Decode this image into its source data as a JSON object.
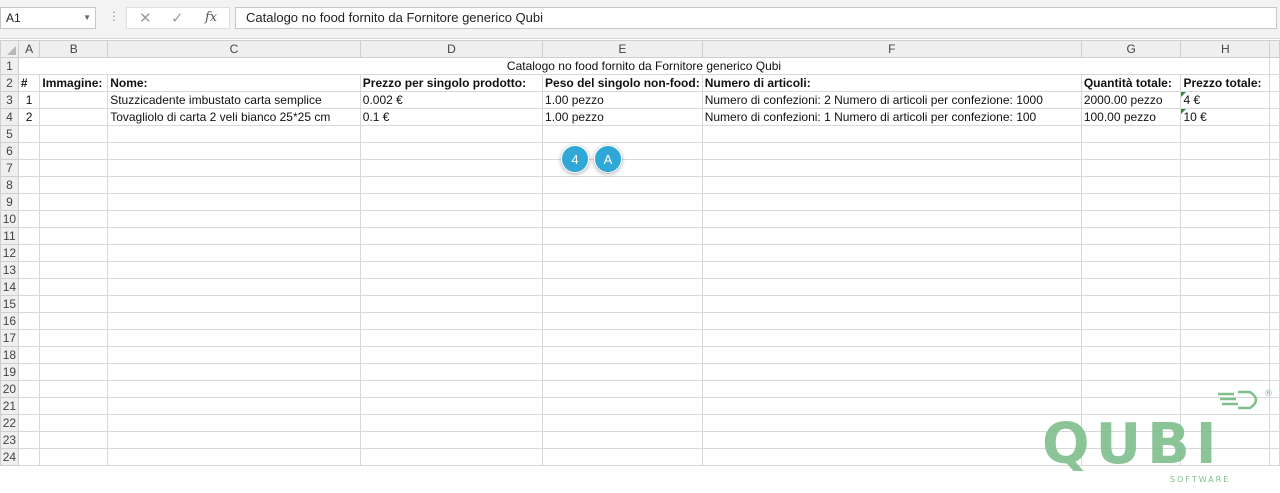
{
  "formula_bar": {
    "name_box": "A1",
    "formula": "Catalogo no food fornito da Fornitore generico Qubi",
    "icons": [
      "cancel-icon",
      "enter-icon",
      "function-icon"
    ]
  },
  "columns": [
    "A",
    "B",
    "C",
    "D",
    "E",
    "F",
    "G",
    "H"
  ],
  "rows": [
    "1",
    "2",
    "3",
    "4",
    "5",
    "6",
    "7",
    "8",
    "9",
    "10",
    "11",
    "12",
    "13",
    "14",
    "15",
    "16",
    "17",
    "18",
    "19",
    "20",
    "21",
    "22",
    "23",
    "24"
  ],
  "sheet": {
    "title": "Catalogo no food fornito da Fornitore generico Qubi",
    "headers": [
      "#",
      "Immagine:",
      "Nome:",
      "Prezzo per singolo prodotto:",
      "Peso del singolo non-food:",
      "Numero di articoli:",
      "Quantità totale:",
      "Prezzo totale:"
    ],
    "data_rows": [
      [
        "1",
        "",
        "Stuzzicadente imbustato carta semplice",
        "0.002 €",
        "1.00 pezzo",
        "Numero di confezioni: 2 Numero di articoli per confezione: 1000",
        "2000.00 pezzo",
        "4 €"
      ],
      [
        "2",
        "",
        "Tovagliolo di carta 2 veli bianco 25*25 cm",
        "0.1 €",
        "1.00 pezzo",
        "Numero di confezioni: 1 Numero di articoli per confezione: 100",
        "100.00 pezzo",
        "10 €"
      ]
    ]
  },
  "badges": [
    "4",
    "A"
  ],
  "logo": {
    "wordmark": "QUBI",
    "tagline": "SOFTWARE",
    "color": "#7fbf8c"
  },
  "colors": {
    "header_bg": "#efefef",
    "grid_line": "#d8d8d8",
    "badge": "#2fa8d8"
  }
}
